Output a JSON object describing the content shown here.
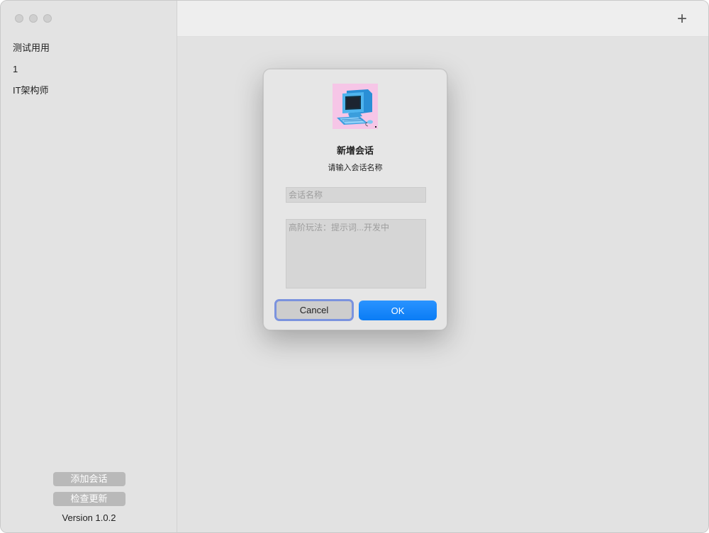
{
  "sidebar": {
    "sessions": [
      {
        "label": "测试用用"
      },
      {
        "label": "1"
      },
      {
        "label": "IT架构师"
      }
    ],
    "add_session_label": "添加会话",
    "check_update_label": "检查更新",
    "version_label": "Version 1.0.2"
  },
  "toolbar": {
    "add_icon": "plus-icon",
    "add_glyph": "+"
  },
  "dialog": {
    "icon": "computer-app-icon",
    "title": "新增会话",
    "subtitle": "请输入会话名称",
    "name_placeholder": "会话名称",
    "name_value": "",
    "prompt_placeholder": "高阶玩法：提示词...开发中",
    "prompt_value": "",
    "cancel_label": "Cancel",
    "ok_label": "OK"
  },
  "colors": {
    "accent": "#0a7cf5",
    "focus_ring": "#7b93de",
    "icon_bg": "#f6c6e7"
  }
}
